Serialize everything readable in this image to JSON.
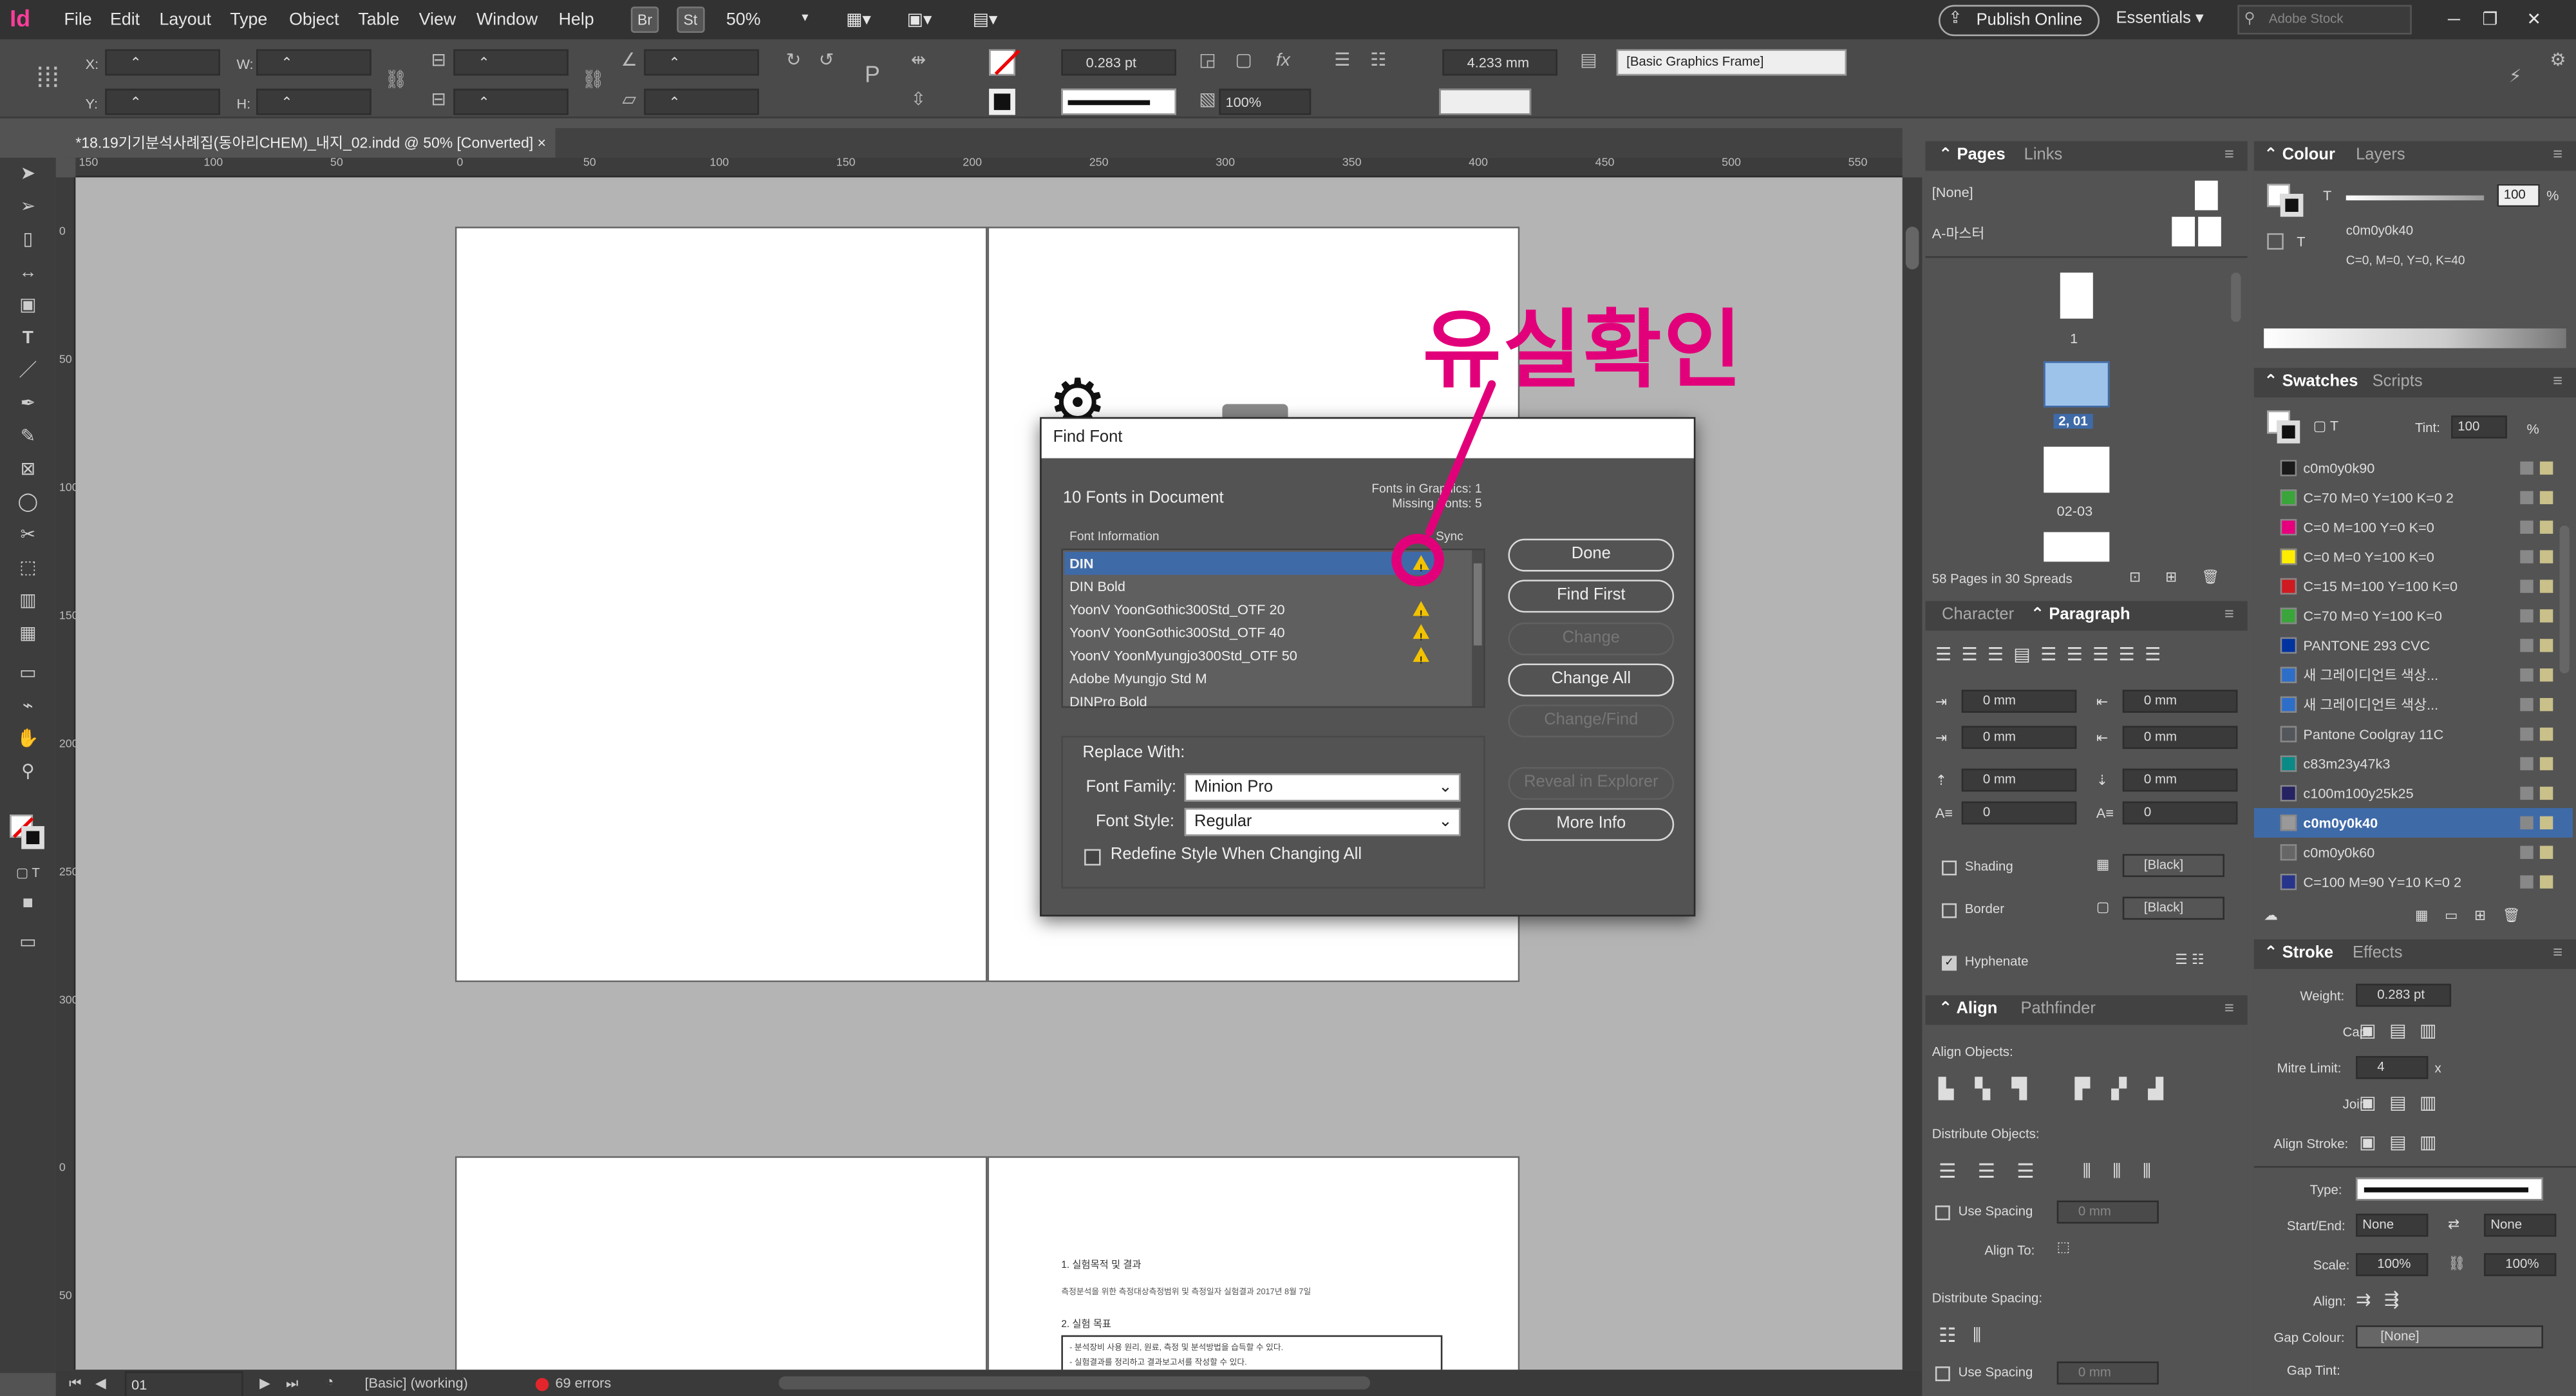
{
  "app": {
    "logo": "Id",
    "menus": [
      "File",
      "Edit",
      "Layout",
      "Type",
      "Object",
      "Table",
      "View",
      "Window",
      "Help"
    ],
    "badge_br": "Br",
    "badge_st": "St",
    "zoom": "50%",
    "publish": "Publish Online",
    "workspace": "Essentials",
    "search_placeholder": "Adobe Stock"
  },
  "control": {
    "x_label": "X:",
    "y_label": "Y:",
    "w_label": "W:",
    "h_label": "H:",
    "stroke_weight": "0.283 pt",
    "scale": "100%",
    "dimension": "4.233 mm",
    "object_style": "[Basic Graphics Frame]"
  },
  "tab": {
    "title": "*18.19기기분석사례집(동아리CHEM)_내지_02.indd @ 50% [Converted]",
    "close": "×"
  },
  "ruler": {
    "h_ticks": [
      "150",
      "100",
      "50",
      "0",
      "50",
      "100",
      "150",
      "200",
      "250",
      "300",
      "350",
      "400",
      "450",
      "500",
      "550"
    ],
    "v_ticks": [
      "0",
      "50",
      "100",
      "150",
      "200",
      "250",
      "300",
      "0",
      "50"
    ]
  },
  "annotation": "유실확인",
  "dialog": {
    "title": "Find Font",
    "fonts_count": "10 Fonts in Document",
    "fonts_in_graphics": "Fonts in Graphics: 1",
    "missing_fonts": "Missing Fonts: 5",
    "col_info": "Font Information",
    "col_sync": "Sync",
    "fonts": [
      {
        "name": "DIN",
        "missing": true,
        "selected": true
      },
      {
        "name": "DIN Bold",
        "missing": false,
        "selected": false
      },
      {
        "name": "YoonV YoonGothic300Std_OTF 20",
        "missing": true,
        "selected": false
      },
      {
        "name": "YoonV YoonGothic300Std_OTF 40",
        "missing": true,
        "selected": false
      },
      {
        "name": "YoonV YoonMyungjo300Std_OTF 50",
        "missing": true,
        "selected": false
      },
      {
        "name": "Adobe Myungjo Std M",
        "missing": false,
        "selected": false
      },
      {
        "name": "DINPro Bold",
        "missing": false,
        "selected": false
      }
    ],
    "replace_with": "Replace With:",
    "family_label": "Font Family:",
    "family_value": "Minion Pro",
    "style_label": "Font Style:",
    "style_value": "Regular",
    "redefine": "Redefine Style When Changing All",
    "buttons": {
      "done": "Done",
      "find_first": "Find First",
      "change": "Change",
      "change_all": "Change All",
      "change_find": "Change/Find",
      "reveal": "Reveal in Explorer",
      "more_info": "More Info"
    }
  },
  "status": {
    "page": "01",
    "style": "[Basic] (working)",
    "errors": "69 errors"
  },
  "pages_panel": {
    "tab_pages": "Pages",
    "tab_links": "Links",
    "none": "[None]",
    "master": "A-마스터",
    "page1": "1",
    "page_sel": "2, 01",
    "page3": "02-03",
    "summary": "58 Pages in 30 Spreads"
  },
  "colour_panel": {
    "tab_colour": "Colour",
    "tab_layers": "Layers",
    "t": "T",
    "tint": "100",
    "pct": "%",
    "name": "c0m0y0k40",
    "values": "C=0, M=0, Y=0, K=40"
  },
  "swatches": {
    "tab_swatches": "Swatches",
    "tab_scripts": "Scripts",
    "tint_label": "Tint:",
    "tint": "100",
    "pct": "%",
    "items": [
      {
        "name": "c0m0y0k90",
        "color": "#1a1a1a"
      },
      {
        "name": "C=70 M=0 Y=100 K=0 2",
        "color": "#3aa53a"
      },
      {
        "name": "C=0 M=100 Y=0 K=0",
        "color": "#e6007e"
      },
      {
        "name": "C=0 M=0 Y=100 K=0",
        "color": "#ffed00"
      },
      {
        "name": "C=15 M=100 Y=100 K=0",
        "color": "#cf1a20"
      },
      {
        "name": "C=70 M=0 Y=100 K=0",
        "color": "#3aa53a"
      },
      {
        "name": "PANTONE 293 CVC",
        "color": "#0033a0"
      },
      {
        "name": "새 그레이디언트 색상...",
        "color": "#2d6ec9"
      },
      {
        "name": "새 그레이디언트 색상...",
        "color": "#2d6ec9"
      },
      {
        "name": "Pantone Coolgray 11C",
        "color": "#53565a"
      },
      {
        "name": "c83m23y47k3",
        "color": "#0a8a86"
      },
      {
        "name": "c100m100y25k25",
        "color": "#262363"
      },
      {
        "name": "c0m0y0k40",
        "color": "#999999"
      },
      {
        "name": "c0m0y0k60",
        "color": "#666666"
      },
      {
        "name": "C=100 M=90 Y=10 K=0 2",
        "color": "#27348b"
      }
    ]
  },
  "paragraph_panel": {
    "tab_character": "Character",
    "tab_paragraph": "Paragraph",
    "zero_mm": "0 mm",
    "zero": "0",
    "shading": "Shading",
    "border": "Border",
    "black": "[Black]",
    "hyphenate": "Hyphenate"
  },
  "align_panel": {
    "tab_align": "Align",
    "tab_pathfinder": "Pathfinder",
    "align_objects": "Align Objects:",
    "distribute_objects": "Distribute Objects:",
    "use_spacing": "Use Spacing",
    "zero_mm": "0 mm",
    "align_to": "Align To:",
    "distribute_spacing": "Distribute Spacing:"
  },
  "stroke_panel": {
    "tab_stroke": "Stroke",
    "tab_effects": "Effects",
    "weight_label": "Weight:",
    "weight": "0.283 pt",
    "cap_label": "Cap:",
    "mitre_label": "Mitre Limit:",
    "mitre": "4",
    "x": "x",
    "join_label": "Join:",
    "align_stroke_label": "Align Stroke:",
    "type_label": "Type:",
    "start_end_label": "Start/End:",
    "none": "None",
    "scale_label": "Scale:",
    "scale": "100%",
    "align_label": "Align:",
    "gap_colour_label": "Gap Colour:",
    "gap_none": "[None]",
    "gap_tint_label": "Gap Tint:"
  },
  "doc_text": {
    "heading1": "1. 실험목적 및 결과",
    "line1": "측정분석을 위한 측정대상측정범위 및 측정일자 실험결과 2017년 8월 7일",
    "heading2": "2. 실험 목표",
    "box1": "- 분석장비 사용 원리, 원료, 측정 및 분석방법을 습득할 수 있다.",
    "box2": "- 실험결과를 정리하고 결과보고서를 작성할 수 있다."
  }
}
